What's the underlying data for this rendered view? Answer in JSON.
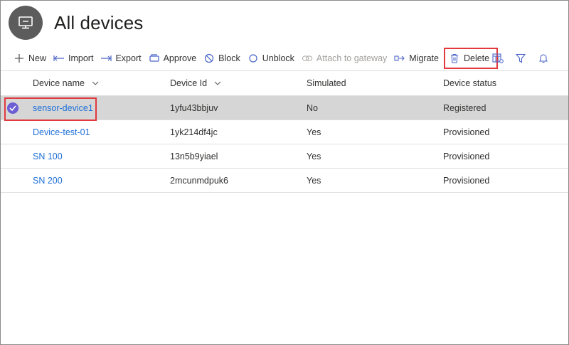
{
  "header": {
    "title": "All devices",
    "icon": "devices-icon"
  },
  "toolbar": {
    "new_label": "New",
    "import_label": "Import",
    "export_label": "Export",
    "approve_label": "Approve",
    "block_label": "Block",
    "unblock_label": "Unblock",
    "attach_label": "Attach to gateway",
    "migrate_label": "Migrate",
    "delete_label": "Delete"
  },
  "table": {
    "columns": [
      "Device name",
      "Device Id",
      "Simulated",
      "Device status"
    ],
    "rows": [
      {
        "name": "sensor-device1",
        "id": "1yfu43bbjuv",
        "simulated": "No",
        "status": "Registered",
        "selected": true
      },
      {
        "name": "Device-test-01",
        "id": "1yk214df4jc",
        "simulated": "Yes",
        "status": "Provisioned",
        "selected": false
      },
      {
        "name": "SN 100",
        "id": "13n5b9yiael",
        "simulated": "Yes",
        "status": "Provisioned",
        "selected": false
      },
      {
        "name": "SN 200",
        "id": "2mcunmdpuk6",
        "simulated": "Yes",
        "status": "Provisioned",
        "selected": false
      }
    ]
  },
  "colors": {
    "link": "#2070d8",
    "highlight": "#e0393e",
    "check": "#6b5fd3",
    "selected_row": "#d6d6d6"
  }
}
